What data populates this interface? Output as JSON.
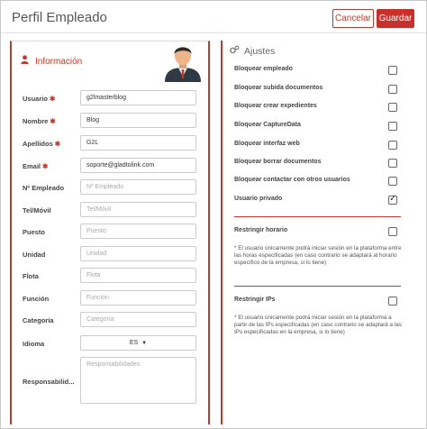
{
  "header": {
    "title": "Perfil Empleado",
    "cancel_label": "Cancelar",
    "save_label": "Guardar"
  },
  "info": {
    "heading": "Información",
    "fields": [
      {
        "label": "Usuario",
        "required": true,
        "value": "g2lmasterblog",
        "placeholder": ""
      },
      {
        "label": "Nombre",
        "required": true,
        "value": "Blog",
        "placeholder": ""
      },
      {
        "label": "Apellidos",
        "required": true,
        "value": "G2L",
        "placeholder": ""
      },
      {
        "label": "Email",
        "required": true,
        "value": "soporte@gladtolink.com",
        "placeholder": ""
      },
      {
        "label": "Nº Empleado",
        "required": false,
        "value": "",
        "placeholder": "Nº Empleado"
      },
      {
        "label": "Tel/Móvil",
        "required": false,
        "value": "",
        "placeholder": "Tel/Móvil"
      },
      {
        "label": "Puesto",
        "required": false,
        "value": "",
        "placeholder": "Puesto"
      },
      {
        "label": "Unidad",
        "required": false,
        "value": "",
        "placeholder": "Unidad"
      },
      {
        "label": "Flota",
        "required": false,
        "value": "",
        "placeholder": "Flota"
      },
      {
        "label": "Función",
        "required": false,
        "value": "",
        "placeholder": "Función"
      },
      {
        "label": "Categoría",
        "required": false,
        "value": "",
        "placeholder": "Categoría"
      }
    ],
    "language": {
      "label": "Idioma",
      "value": "ES"
    },
    "responsibilities": {
      "label": "Responsabilid...",
      "placeholder": "Responsabilidades"
    }
  },
  "settings": {
    "heading": "Ajustes",
    "items": [
      {
        "label": "Bloquear empleado",
        "checked": false
      },
      {
        "label": "Bloquear subida documentos",
        "checked": false
      },
      {
        "label": "Bloquear crear expedientes",
        "checked": false
      },
      {
        "label": "Bloquear CaptureData",
        "checked": false
      },
      {
        "label": "Bloquear interfaz web",
        "checked": false
      },
      {
        "label": "Bloquear borrar documentos",
        "checked": false
      },
      {
        "label": "Bloquear contactar con otros usuarios",
        "checked": false
      },
      {
        "label": "Usuario privado",
        "checked": true
      }
    ],
    "schedule": {
      "label": "Restringir horario",
      "checked": false,
      "note": "* El usuario únicamente podrá iniciar sesión en la plataforma entre las horas especificadas (en caso contrario se adaptará al horario específico de la empresa, si lo tiene)"
    },
    "ips": {
      "label": "Restringir IPs",
      "checked": false,
      "note": "* El usuario únicamente podrá iniciar sesión en la plataforma a partir de las IPs especificadas (en caso contrario se adaptará a las IPs especificadas en la empresa, si lo tiene)"
    }
  },
  "colors": {
    "accent": "#c0392b"
  },
  "icons": [
    "user-icon",
    "gears-icon",
    "avatar-image",
    "caret-down-icon",
    "checkmark-icon"
  ]
}
